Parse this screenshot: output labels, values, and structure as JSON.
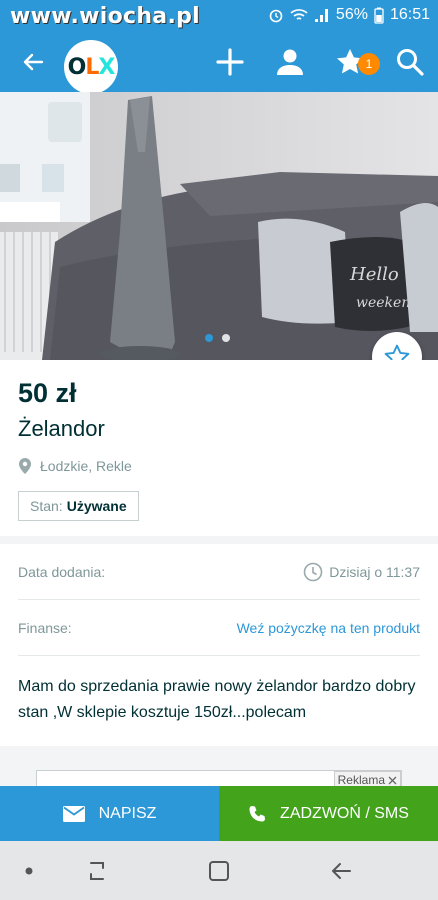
{
  "watermark": "www.wiocha.pl",
  "status": {
    "battery": "56%",
    "time": "16:51"
  },
  "app_bar": {
    "logo_o": "O",
    "logo_l": "L",
    "logo_x": "X",
    "favorites_count": "1"
  },
  "gallery": {
    "image_count": 2,
    "current_index": 1,
    "caption_on_pillow": "Hello weekend"
  },
  "listing": {
    "price": "50 zł",
    "title": "Żelandor",
    "location": "Łodzkie, Rekle",
    "condition_label": "Stan:",
    "condition_value": "Używane"
  },
  "details": {
    "date_label": "Data dodania:",
    "date_value": "Dzisiaj o 11:37",
    "finance_label": "Finanse:",
    "finance_link": "Weź pożyczkę na ten produkt",
    "description": "Mam do sprzedania prawie nowy żelandor bardzo dobry stan ,W sklepie kosztuje 150zł...polecam"
  },
  "ad": {
    "label": "Reklama"
  },
  "actions": {
    "write_label": "NAPISZ",
    "call_label": "ZADZWOŃ / SMS"
  },
  "colors": {
    "primary": "#2c98d7",
    "call_green": "#43a31b",
    "badge_orange": "#ff8a00",
    "text_dark": "#002f34"
  }
}
